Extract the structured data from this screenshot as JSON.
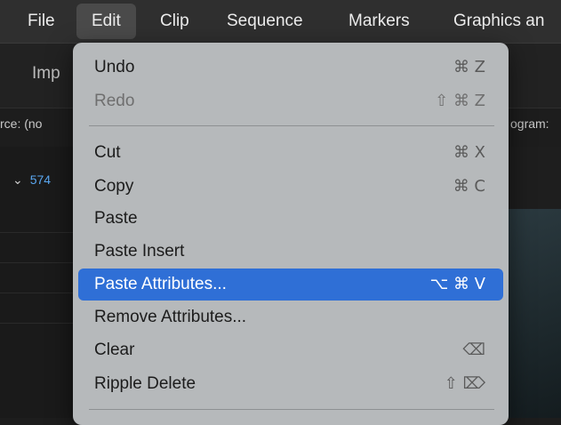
{
  "menubar": {
    "items": [
      {
        "label": "File"
      },
      {
        "label": "Edit"
      },
      {
        "label": "Clip"
      },
      {
        "label": "Sequence"
      },
      {
        "label": "Markers"
      },
      {
        "label": "Graphics an"
      }
    ]
  },
  "background": {
    "import_label": "Imp",
    "source_label": "rce: (no",
    "program_label": "ogram:",
    "bin_label": "574"
  },
  "edit_menu": {
    "items": [
      {
        "label": "Undo",
        "shortcut": "⌘ Z",
        "enabled": true
      },
      {
        "label": "Redo",
        "shortcut": "⇧ ⌘ Z",
        "enabled": false
      },
      {
        "label": "Cut",
        "shortcut": "⌘ X",
        "enabled": true
      },
      {
        "label": "Copy",
        "shortcut": "⌘ C",
        "enabled": true
      },
      {
        "label": "Paste",
        "shortcut": "",
        "enabled": true
      },
      {
        "label": "Paste Insert",
        "shortcut": "",
        "enabled": true
      },
      {
        "label": "Paste Attributes...",
        "shortcut": "⌥ ⌘ V",
        "enabled": true,
        "highlighted": true
      },
      {
        "label": "Remove Attributes...",
        "shortcut": "",
        "enabled": true
      },
      {
        "label": "Clear",
        "shortcut": "⌫",
        "enabled": true
      },
      {
        "label": "Ripple Delete",
        "shortcut": "⇧ ⌦",
        "enabled": true
      }
    ]
  },
  "colors": {
    "highlight": "#2f6fd6",
    "menubar_bg": "#2f2f2f",
    "menu_bg": "#bcc0c2",
    "bin_accent": "#5aa7f0"
  }
}
